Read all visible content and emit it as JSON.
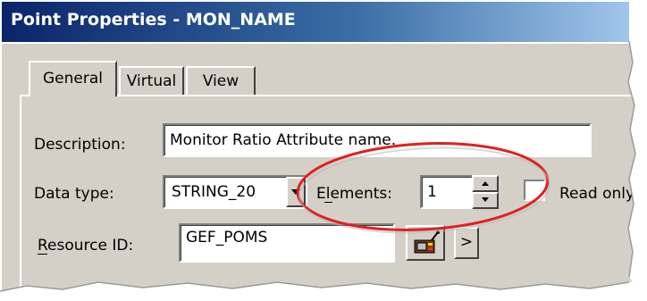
{
  "window": {
    "title": "Point Properties - MON_NAME",
    "title_bar_color": "#0a246a"
  },
  "tabs": [
    {
      "label": "General",
      "selected": true
    },
    {
      "label": "Virtual",
      "selected": false
    },
    {
      "label": "View",
      "selected": false
    }
  ],
  "form": {
    "description": {
      "label": "Description:",
      "value": "Monitor Ratio Attribute name."
    },
    "data_type": {
      "label": "Data type:",
      "value": "STRING_20"
    },
    "elements": {
      "label": "Elements:",
      "value": "1"
    },
    "read_only": {
      "label": "Read only",
      "checked": false
    },
    "resource_id": {
      "label": "Resource ID:",
      "value": "GEF_POMS",
      "browse_icon": "resource-browser-icon",
      "arrow": ">"
    }
  },
  "annotation": {
    "highlight_color": "#e02020"
  },
  "colors": {
    "dialog_face": "#d4d0c8",
    "field_bg": "#ffffff"
  }
}
